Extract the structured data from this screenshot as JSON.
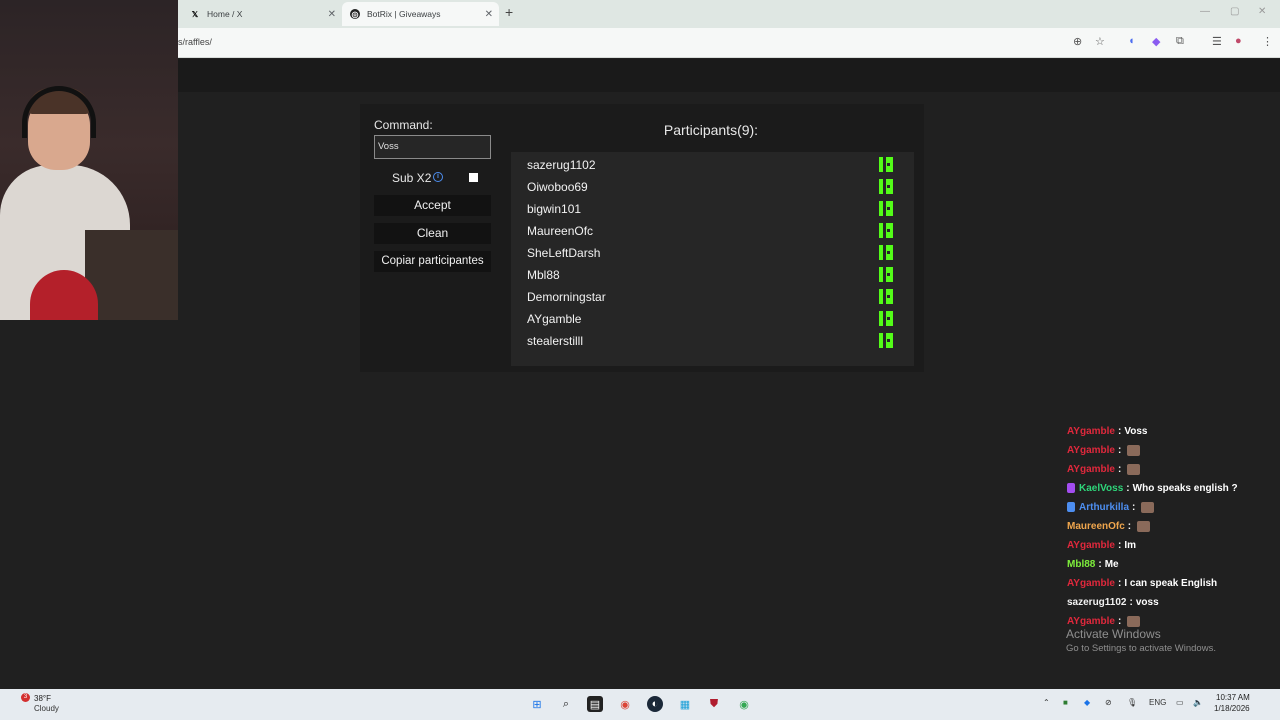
{
  "browser": {
    "tabs": [
      {
        "title": "Home / X",
        "icon": "x-logo-icon"
      },
      {
        "title": "BotRix | Giveaways",
        "icon": "botrix-icon"
      }
    ],
    "url": "s/raffles/"
  },
  "raffle": {
    "command_label": "Command:",
    "command_value": "Voss",
    "sub_label": "Sub X2",
    "sub_checked": false,
    "accept_label": "Accept",
    "clean_label": "Clean",
    "copy_label": "Copiar participantes",
    "participants_title": "Participants(9):",
    "participants": [
      "sazerug1102",
      "Oiwoboo69",
      "bigwin101",
      "MaureenOfc",
      "SheLeftDarsh",
      "Mbl88",
      "Demorningstar",
      "AYgamble",
      "stealerstilll"
    ]
  },
  "chat": {
    "messages": [
      {
        "user": "AYgamble",
        "color": "#e0283c",
        "text": "Voss",
        "emote": false,
        "badge": ""
      },
      {
        "user": "AYgamble",
        "color": "#e0283c",
        "text": "",
        "emote": true,
        "badge": ""
      },
      {
        "user": "AYgamble",
        "color": "#e0283c",
        "text": "",
        "emote": true,
        "badge": ""
      },
      {
        "user": "KaelVoss",
        "color": "#2ed67a",
        "text": "Who speaks english ?",
        "emote": false,
        "badge": "#a34df0"
      },
      {
        "user": "Arthurkilla",
        "color": "#4d8ef0",
        "text": "",
        "emote": true,
        "badge": "#4d8ef0"
      },
      {
        "user": "MaureenOfc",
        "color": "#f0a64d",
        "text": "",
        "emote": true,
        "badge": ""
      },
      {
        "user": "AYgamble",
        "color": "#e0283c",
        "text": "Im",
        "emote": false,
        "badge": ""
      },
      {
        "user": "Mbl88",
        "color": "#7ef03c",
        "text": "Me",
        "emote": false,
        "badge": ""
      },
      {
        "user": "AYgamble",
        "color": "#e0283c",
        "text": "I can speak English",
        "emote": false,
        "badge": ""
      },
      {
        "user": "sazerug1102",
        "color": "#f2f2f2",
        "text": "voss",
        "emote": false,
        "badge": ""
      },
      {
        "user": "AYgamble",
        "color": "#e0283c",
        "text": "",
        "emote": true,
        "badge": ""
      }
    ],
    "separator": ":"
  },
  "watermark": {
    "line1": "Activate Windows",
    "line2": "Go to Settings to activate Windows."
  },
  "taskbar": {
    "temperature": "38°F",
    "condition": "Cloudy",
    "notification_count": "3",
    "language": "ENG",
    "time": "10:37 AM",
    "date": "1/18/2026",
    "apps": [
      "windows-start-icon",
      "search-icon",
      "file-explorer-icon",
      "chrome-icon",
      "steam-icon",
      "notepad-icon",
      "shield-app-icon",
      "chrome-profile-icon"
    ]
  }
}
